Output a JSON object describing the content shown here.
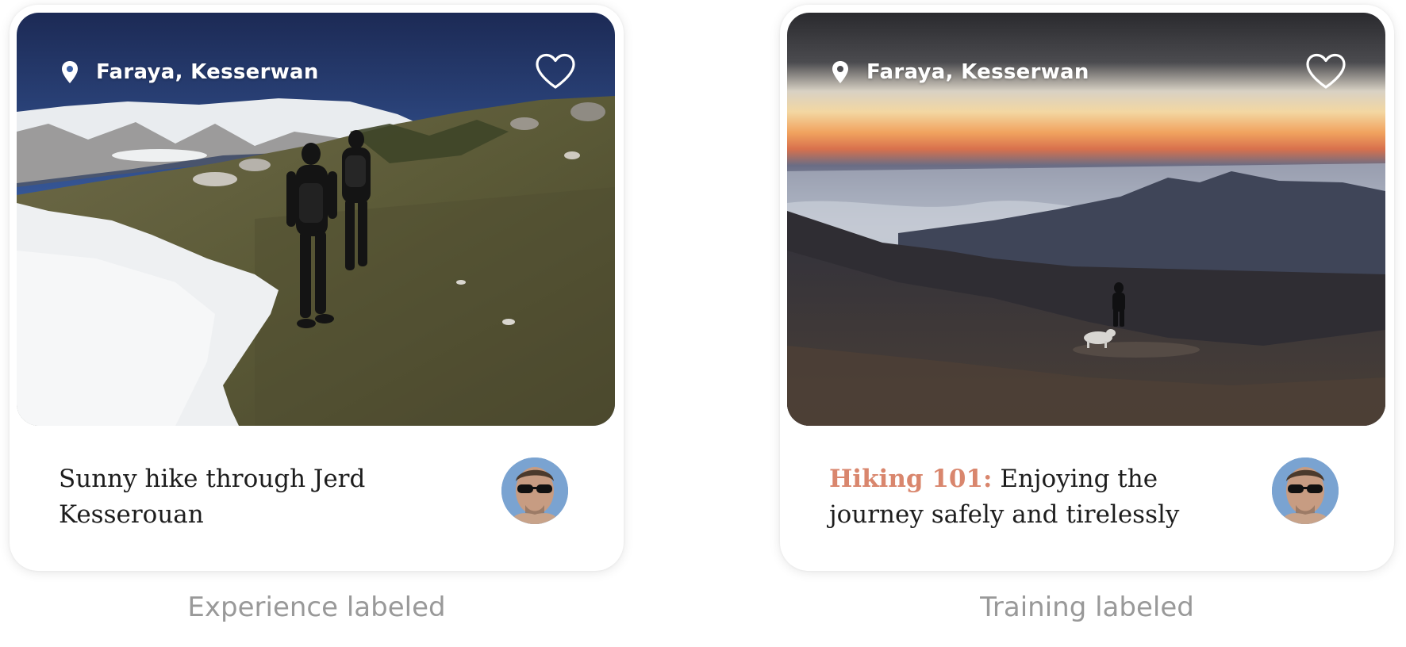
{
  "cards": [
    {
      "location": "Faraya, Kesserwan",
      "title_accent": "",
      "title": "Sunny hike through  Jerd Kesserouan",
      "label": "Experience labeled"
    },
    {
      "location": "Faraya, Kesserwan",
      "title_accent": "Hiking 101:",
      "title": " Enjoying the journey safely and tirelessly",
      "label": "Training labeled"
    }
  ],
  "icons": {
    "location": "map-pin-icon",
    "favorite": "heart-outline-icon"
  },
  "colors": {
    "accent": "#d9866d",
    "caption": "#999999",
    "title": "#1d1d1d"
  }
}
